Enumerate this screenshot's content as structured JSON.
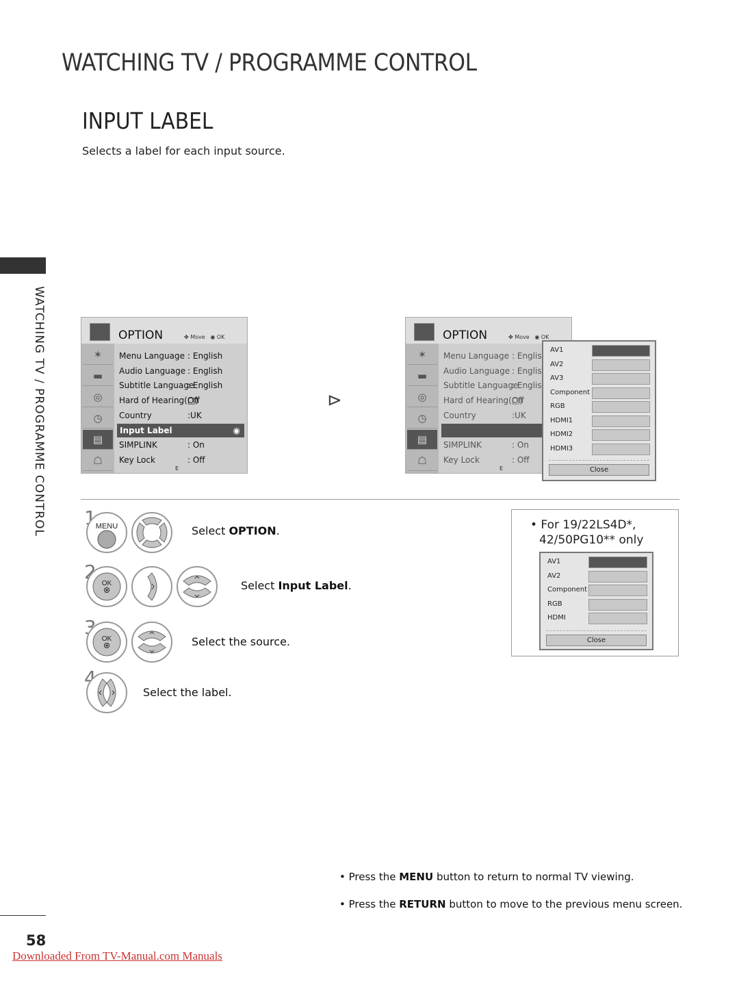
{
  "header": {
    "section": "WATCHING TV / PROGRAMME CONTROL",
    "title": "INPUT LABEL",
    "subtitle": "Selects a label for each input source."
  },
  "side_tab": "WATCHING TV / PROGRAMME CONTROL",
  "menu": {
    "title": "OPTION",
    "nav_hint": "Move",
    "ok_hint": "OK",
    "footer": "E",
    "items": [
      {
        "label": "Menu Language",
        "value": ": English"
      },
      {
        "label": "Audio Language",
        "value": ": English"
      },
      {
        "label": "Subtitle Language",
        "value": ": English"
      },
      {
        "label": "Hard of Hearing(□)",
        "value": "Off"
      },
      {
        "label": "Country",
        "value": ":UK"
      },
      {
        "label": "Input Label",
        "value": ""
      },
      {
        "label": "SIMPLINK",
        "value": ": On"
      },
      {
        "label": "Key Lock",
        "value": ": Off"
      }
    ],
    "selected": "Input Label"
  },
  "popup": {
    "items": [
      "AV1",
      "AV2",
      "AV3",
      "Component",
      "RGB",
      "HDMI1",
      "HDMI2",
      "HDMI3"
    ],
    "selected": "AV1",
    "close": "Close"
  },
  "steps": [
    {
      "num": "1",
      "text": "Select ",
      "bold": "OPTION",
      "after": ".",
      "buttons": [
        "MENU",
        "navigation"
      ]
    },
    {
      "num": "2",
      "text": "Select ",
      "bold": "Input Label",
      "after": ".",
      "buttons": [
        "OK",
        "right",
        "up-down"
      ]
    },
    {
      "num": "3",
      "text": "Select the source.",
      "buttons": [
        "OK",
        "up-down"
      ]
    },
    {
      "num": "4",
      "text": "Select the label.",
      "buttons": [
        "left-right"
      ]
    }
  ],
  "button_labels": {
    "menu": "MENU",
    "ok": "OK"
  },
  "note": {
    "line1": "• For 19/22LS4D*,",
    "line2": "42/50PG10** only",
    "items": [
      "AV1",
      "AV2",
      "Component",
      "RGB",
      "HDMI"
    ],
    "selected": "AV1",
    "close": "Close"
  },
  "bullets": [
    {
      "pre": "• Press the ",
      "bold": "MENU",
      "post": " button to return to normal TV viewing."
    },
    {
      "pre": "• Press the ",
      "bold": "RETURN",
      "post": " button to move to the previous menu screen."
    }
  ],
  "page_number": "58",
  "download_link": "Downloaded From TV-Manual.com Manuals"
}
